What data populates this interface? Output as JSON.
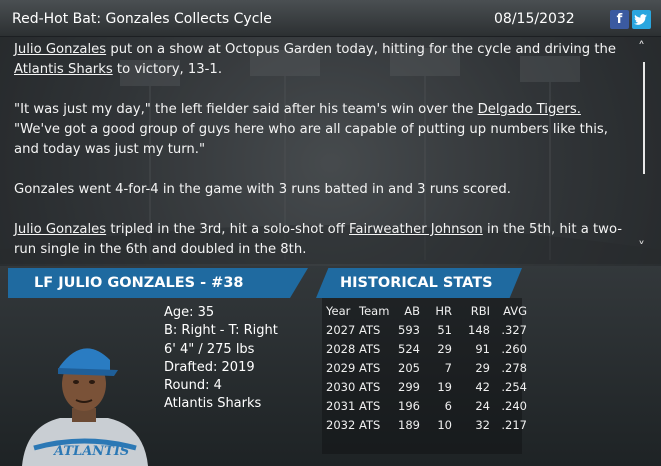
{
  "header": {
    "title": "Red-Hot Bat: Gonzales Collects Cycle",
    "date": "08/15/2032",
    "facebook_icon": "f",
    "twitter_icon": "t"
  },
  "article": {
    "p1_link1": "Julio Gonzales",
    "p1_text1": " put on a show at Octopus Garden today, hitting for the cycle and driving the ",
    "p1_link2": "Atlantis Sharks",
    "p1_text2": " to victory, 13-1.",
    "p2_text1": "\"It was just my day,\" the left fielder said after his team's win over the ",
    "p2_link1": "Delgado Tigers.",
    "p2_text2": " \"We've got a good group of guys here who are all capable of putting up numbers like this, and today was just my turn.\"",
    "p3_text1": "Gonzales went 4-for-4 in the game with 3 runs batted in and 3 runs scored.",
    "p4_link1": "Julio Gonzales",
    "p4_text1": " tripled in the 3rd, hit a solo-shot off ",
    "p4_link2": "Fairweather Johnson",
    "p4_text2": " in the 5th, hit a two-run single in the 6th and doubled in the 8th."
  },
  "player": {
    "banner": "LF JULIO GONZALES - #38",
    "age": "Age: 35",
    "bats_throws": "B: Right - T: Right",
    "size": "6' 4\" / 275 lbs",
    "drafted": "Drafted: 2019",
    "round": "Round: 4",
    "team": "Atlantis Sharks"
  },
  "historical_stats": {
    "banner": "HISTORICAL STATS",
    "columns": [
      "Year",
      "Team",
      "AB",
      "HR",
      "RBI",
      "AVG"
    ],
    "rows": [
      [
        "2027",
        "ATS",
        "593",
        "51",
        "148",
        ".327"
      ],
      [
        "2028",
        "ATS",
        "524",
        "29",
        "91",
        ".260"
      ],
      [
        "2029",
        "ATS",
        "205",
        "7",
        "29",
        ".278"
      ],
      [
        "2030",
        "ATS",
        "299",
        "19",
        "42",
        ".254"
      ],
      [
        "2031",
        "ATS",
        "196",
        "6",
        "24",
        ".240"
      ],
      [
        "2032",
        "ATS",
        "189",
        "10",
        "32",
        ".217"
      ]
    ]
  }
}
